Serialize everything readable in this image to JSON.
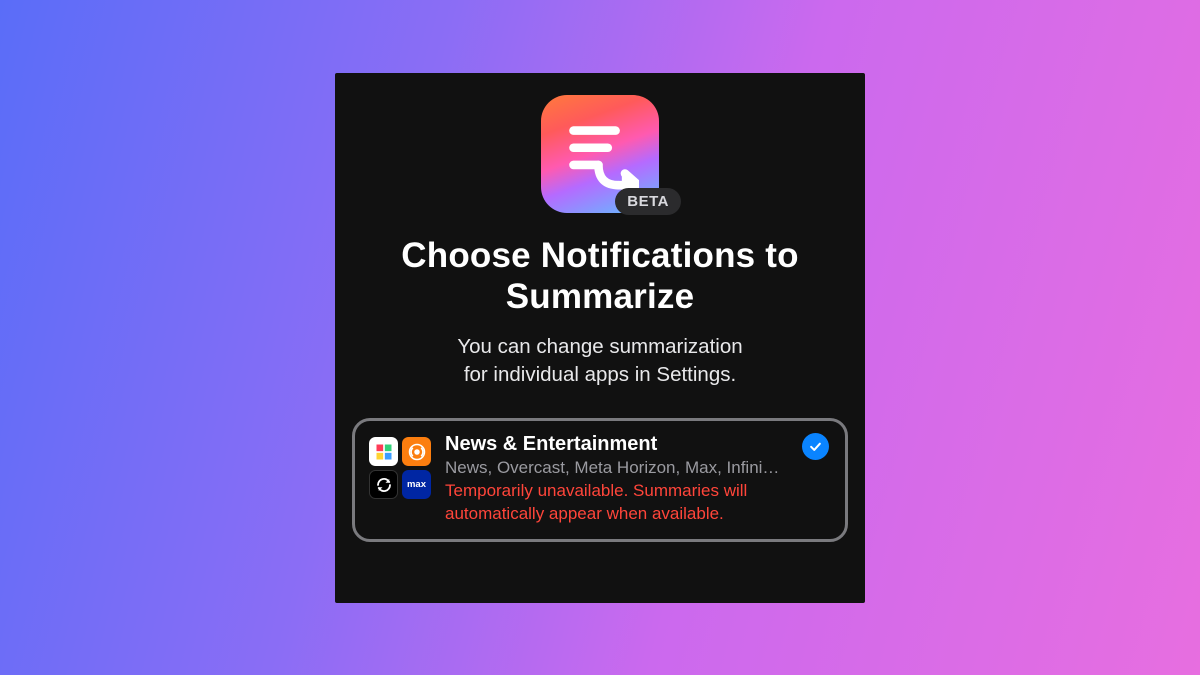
{
  "header": {
    "beta_label": "BETA",
    "title": "Choose Notifications\nto Summarize",
    "subtitle": "You can change summarization\nfor individual apps in Settings."
  },
  "category": {
    "title": "News & Entertainment",
    "apps_line": "News, Overcast, Meta Horizon, Max, Infini…",
    "warning": "Temporarily unavailable. Summaries will automatically appear when available.",
    "selected": true,
    "icon_names": [
      "news-app-icon",
      "overcast-app-icon",
      "sync-app-icon",
      "max-app-icon"
    ],
    "max_label": "max"
  },
  "colors": {
    "warning": "#ff453a",
    "accent": "#0a84ff"
  }
}
